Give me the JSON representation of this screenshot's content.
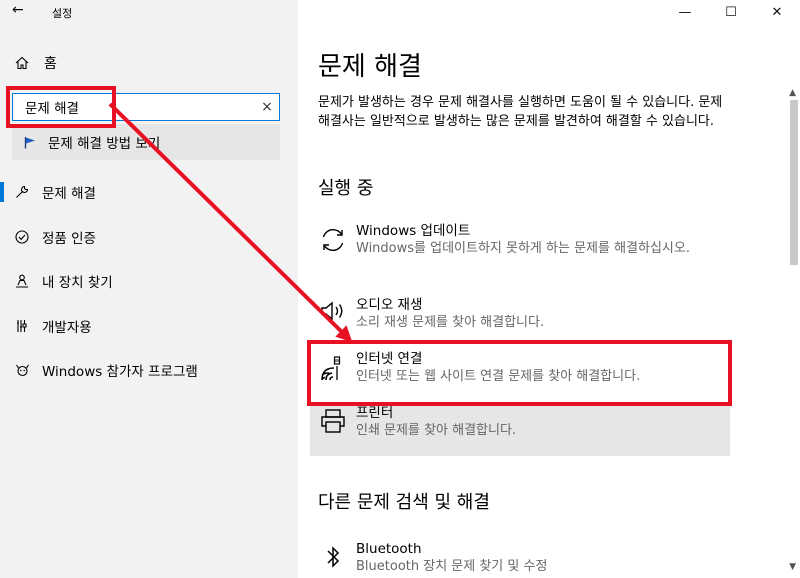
{
  "window": {
    "title": "설정",
    "back_icon": "back-arrow-icon",
    "controls": {
      "minimize": "—",
      "maximize": "☐",
      "close": "✕"
    }
  },
  "sidebar": {
    "home_label": "홈",
    "search": {
      "value": "문제 해결",
      "clear": "×"
    },
    "suggestion": "문제 해결 방법 보기",
    "items": [
      {
        "label": "문제 해결",
        "icon": "wrench-icon",
        "active": true
      },
      {
        "label": "정품 인증",
        "icon": "check-circle-icon",
        "active": false
      },
      {
        "label": "내 장치 찾기",
        "icon": "person-location-icon",
        "active": false
      },
      {
        "label": "개발자용",
        "icon": "developer-tools-icon",
        "active": false
      },
      {
        "label": "Windows 참가자 프로그램",
        "icon": "insider-icon",
        "active": false
      }
    ]
  },
  "main": {
    "title": "문제 해결",
    "description": "문제가 발생하는 경우 문제 해결사를 실행하면 도움이 될 수 있습니다. 문제 해결사는 일반적으로 발생하는 많은 문제를 발견하여 해결할 수 있습니다.",
    "section_running": "실행 중",
    "troubleshooters": [
      {
        "title": "Windows 업데이트",
        "subtitle": "Windows를 업데이트하지 못하게 하는 문제를 해결하십시오.",
        "icon": "refresh-icon"
      },
      {
        "title": "오디오 재생",
        "subtitle": "소리 재생 문제를 찾아 해결합니다.",
        "icon": "speaker-icon"
      },
      {
        "title": "인터넷 연결",
        "subtitle": "인터넷 또는 웹 사이트 연결 문제를 찾아 해결합니다.",
        "icon": "wifi-network-icon"
      },
      {
        "title": "프린터",
        "subtitle": "인쇄 문제를 찾아 해결합니다.",
        "icon": "printer-icon"
      }
    ],
    "section_other": "다른 문제 검색 및 해결",
    "other_troubleshooters": [
      {
        "title": "Bluetooth",
        "subtitle": "Bluetooth 장치 문제 찾기 및 수정",
        "icon": "bluetooth-icon"
      }
    ]
  },
  "annotation": {
    "color": "#e81123"
  }
}
